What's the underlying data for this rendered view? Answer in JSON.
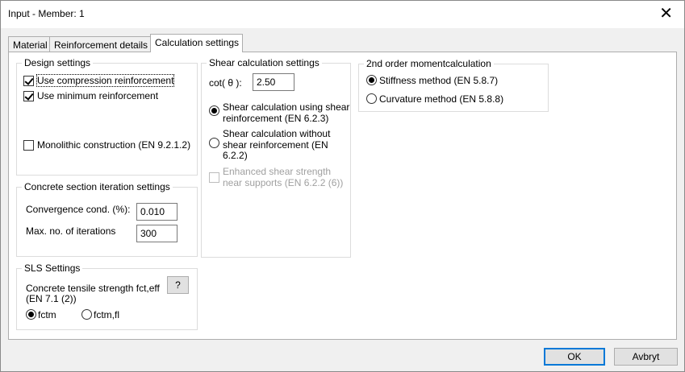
{
  "window": {
    "title": "Input - Member: 1"
  },
  "tabs": [
    {
      "label": "Material"
    },
    {
      "label": "Reinforcement details"
    },
    {
      "label": "Calculation settings"
    }
  ],
  "design": {
    "title": "Design settings",
    "use_compression": "Use compression reinforcement",
    "use_minimum": "Use minimum reinforcement",
    "monolithic": "Monolithic construction (EN 9.2.1.2)"
  },
  "iteration": {
    "title": "Concrete section iteration settings",
    "convergence_label": "Convergence cond. (%):",
    "convergence_value": "0.010",
    "max_iter_label": "Max. no. of iterations",
    "max_iter_value": "300"
  },
  "sls": {
    "title": "SLS Settings",
    "tensile_label_1": "Concrete tensile strength fct,eff",
    "tensile_label_2": "(EN 7.1 (2))",
    "help_label": "?",
    "opt_fctm": "fctm",
    "opt_fctmfl": "fctm,fl"
  },
  "shear": {
    "title": "Shear calculation settings",
    "cot_label": "cot( θ ):",
    "cot_value": "2.50",
    "opt_using_1": "Shear calculation using shear",
    "opt_using_2": "reinforcement (EN 6.2.3)",
    "opt_without_1": "Shear calculation without",
    "opt_without_2": "shear reinforcement (EN",
    "opt_without_3": "6.2.2)",
    "enhanced_1": "Enhanced shear strength",
    "enhanced_2": "near supports (EN 6.2.2 (6))"
  },
  "moment": {
    "title": "2nd order momentcalculation",
    "opt_stiffness": "Stiffness method (EN 5.8.7)",
    "opt_curvature": "Curvature method (EN 5.8.8)"
  },
  "buttons": {
    "ok": "OK",
    "cancel": "Avbryt"
  }
}
